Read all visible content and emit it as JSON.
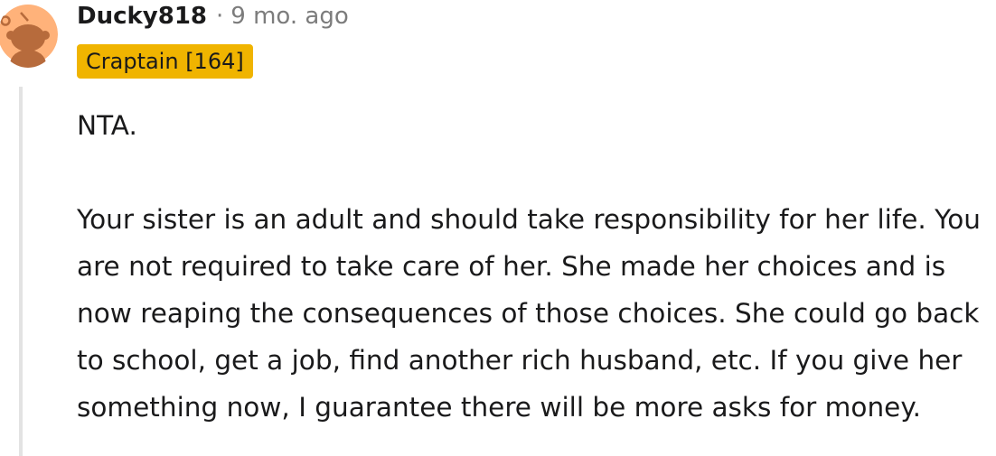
{
  "comment": {
    "author": "Ducky818",
    "separator": "·",
    "timestamp": "9 mo. ago",
    "flair": "Craptain [164]",
    "paragraphs": [
      "NTA.",
      "Your sister is an adult and should take responsibility for her life. You are not required to take care of her. She made her choices and is now reaping the consequences of those choices. She could go back to school, get a job, find another rich husband, etc. If you give her something now, I guarantee there will be more asks for money."
    ]
  },
  "colors": {
    "avatar_bg": "#ffb27a",
    "avatar_figure": "#b76b3c",
    "flair_bg": "#f0b400",
    "meta_gray": "#7c7c7c",
    "thread_line": "#e3e3e3",
    "text": "#1a1a1b"
  },
  "icons": {
    "avatar": "snoo-avatar-icon"
  }
}
